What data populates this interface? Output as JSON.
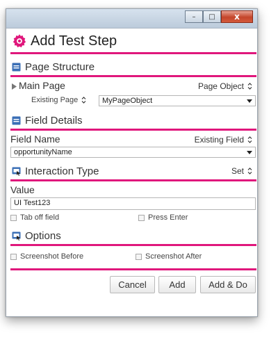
{
  "dialog": {
    "title": "Add Test Step"
  },
  "page_structure": {
    "title": "Page Structure",
    "main_page_label": "Main Page",
    "page_object_label": "Page Object",
    "existing_page_label": "Existing Page",
    "existing_page_value": "MyPageObject"
  },
  "field_details": {
    "title": "Field Details",
    "field_name_label": "Field Name",
    "existing_field_label": "Existing Field",
    "field_value": "opportunityName"
  },
  "interaction": {
    "title": "Interaction Type",
    "type_value": "Set",
    "value_label": "Value",
    "value_input": "UI Test123",
    "tab_off_label": "Tab off field",
    "press_enter_label": "Press Enter"
  },
  "options": {
    "title": "Options",
    "screenshot_before_label": "Screenshot Before",
    "screenshot_after_label": "Screenshot After"
  },
  "buttons": {
    "cancel": "Cancel",
    "add": "Add",
    "add_do": "Add & Do"
  },
  "window_controls": {
    "minimize": "–",
    "maximize": "□",
    "close": "x"
  },
  "colors": {
    "accent": "#e0177c",
    "section_icon": "#3b6fb6"
  }
}
